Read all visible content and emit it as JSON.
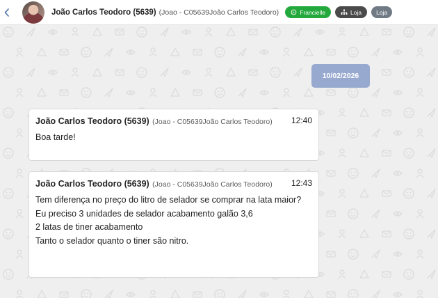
{
  "header": {
    "back_icon": "chevron-left-icon",
    "contact_name": "João Carlos Teodoro (5639)",
    "contact_sub": "(Joao - C05639João Carlos Teodoro)",
    "badges": {
      "whatsapp_label": "Francielle",
      "store_label": "Loja",
      "store2_label": "Loja"
    }
  },
  "chat": {
    "date_separator": "10/02/2026",
    "messages": [
      {
        "sender": "João Carlos Teodoro (5639)",
        "sender_sub": "(Joao - C05639João Carlos Teodoro)",
        "time": "12:40",
        "lines": [
          "Boa tarde!"
        ]
      },
      {
        "sender": "João Carlos Teodoro (5639)",
        "sender_sub": "(Joao - C05639João Carlos Teodoro)",
        "time": "12:43",
        "lines": [
          "Tem diferença no preço do litro de selador se comprar na lata maior?",
          "Eu preciso 3 unidades de selador acabamento galão 3,6",
          "2 latas de tiner acabamento",
          "Tanto o selador quanto o tiner são nitro."
        ]
      }
    ]
  },
  "colors": {
    "whatsapp_badge": "#22a83b",
    "store_badge": "#4a4a4a",
    "store2_badge": "#707a84",
    "date_pill": "#98a9d0",
    "chat_background": "#efefef"
  }
}
